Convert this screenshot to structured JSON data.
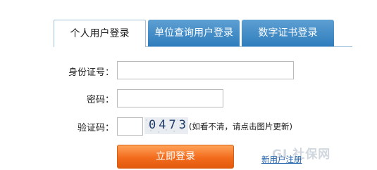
{
  "tabs": [
    {
      "label": "个人用户登录",
      "active": true
    },
    {
      "label": "单位查询用户登录",
      "active": false
    },
    {
      "label": "数字证书登录",
      "active": false
    }
  ],
  "form": {
    "id_label": "身份证号：",
    "id_value": "",
    "password_label": "密码：",
    "password_value": "",
    "captcha_label": "验证码：",
    "captcha_value": "",
    "captcha_image_text": "0473",
    "captcha_hint": "(如看不清，请点击图片更新)",
    "submit_label": "立即登录",
    "register_link": "新用户注册"
  },
  "watermark": "GI 社保网",
  "colors": {
    "tab_inactive_top": "#5d9fd2",
    "tab_inactive_bottom": "#2f7dbd",
    "button_orange": "#f26b1d",
    "link_blue": "#1a5ca8"
  }
}
